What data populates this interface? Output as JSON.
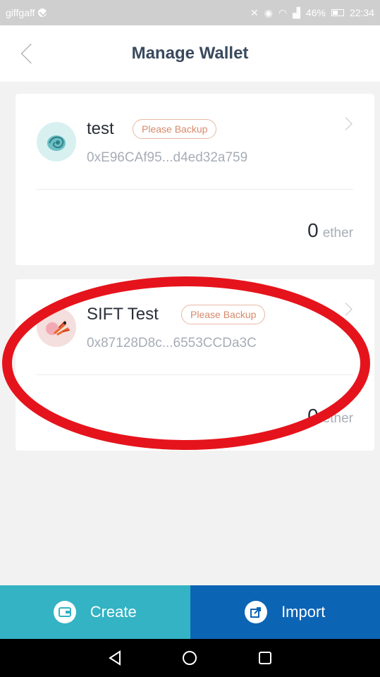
{
  "status_bar": {
    "carrier": "giffgaff",
    "battery_percent": "46%",
    "time": "22:34",
    "icons": [
      "mute-icon",
      "eye-icon",
      "wifi-icon",
      "signal-icon",
      "battery-icon"
    ]
  },
  "header": {
    "title": "Manage Wallet",
    "back_icon": "back-chevron-icon"
  },
  "wallets": [
    {
      "name": "test",
      "badge": "Please Backup",
      "address": "0xE96CAf95...d4ed32a759",
      "balance": "0",
      "unit": "ether",
      "avatar": "shell-avatar"
    },
    {
      "name": "SIFT Test",
      "badge": "Please Backup",
      "address": "0x87128D8c...6553CCDa3C",
      "balance": "0",
      "unit": "ether",
      "avatar": "crab-avatar"
    }
  ],
  "actions": {
    "create_label": "Create",
    "import_label": "Import"
  },
  "colors": {
    "create": "#33b3c3",
    "import": "#0c64b5",
    "badge": "#d8896a",
    "annotation": "#e5141c"
  }
}
